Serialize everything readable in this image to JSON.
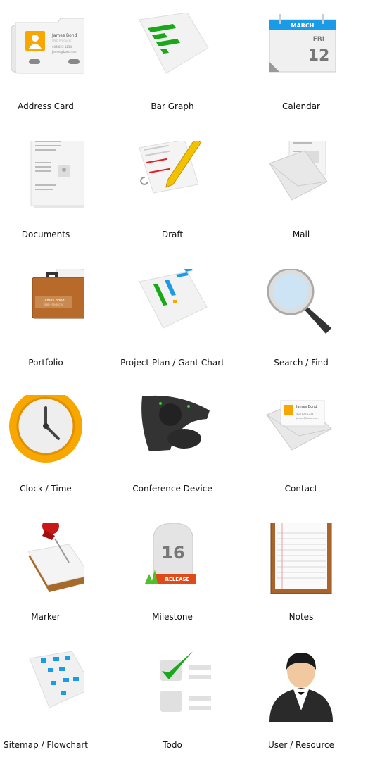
{
  "icons": [
    {
      "label": "Address Card",
      "card": {
        "name": "James Bond",
        "title": "Web Producer",
        "phone": "408 623 1234",
        "email": "james@bond.com"
      }
    },
    {
      "label": "Bar Graph"
    },
    {
      "label": "Calendar",
      "calendar": {
        "month": "MARCH",
        "weekday": "FRI",
        "day": "12"
      }
    },
    {
      "label": "Documents"
    },
    {
      "label": "Draft"
    },
    {
      "label": "Mail"
    },
    {
      "label": "Portfolio",
      "card": {
        "name": "James Bond",
        "title": "Web Producer"
      }
    },
    {
      "label": "Project Plan / Gant Chart"
    },
    {
      "label": "Search / Find"
    },
    {
      "label": "Clock / Time"
    },
    {
      "label": "Conference Device"
    },
    {
      "label": "Contact",
      "card": {
        "name": "James Bond",
        "phone": "408 623 1234",
        "email": "james@bond.com"
      }
    },
    {
      "label": "Marker"
    },
    {
      "label": "Milestone",
      "milestone": {
        "number": "16",
        "tag": "RELEASE"
      }
    },
    {
      "label": "Notes"
    },
    {
      "label": "Sitemap / Flowchart"
    },
    {
      "label": "Todo"
    },
    {
      "label": "User / Resource"
    }
  ],
  "colors": {
    "green": "#1aa81a",
    "blue": "#1a9be8",
    "orange": "#f7a700",
    "red": "#e0401a"
  }
}
